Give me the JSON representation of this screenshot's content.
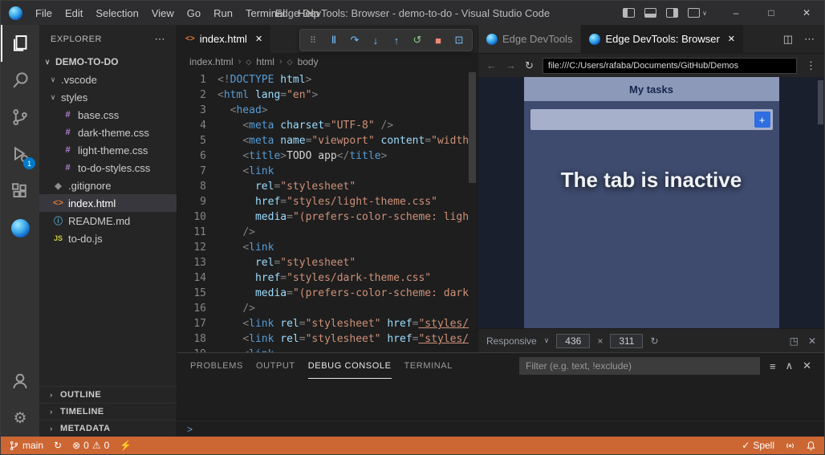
{
  "titlebar": {
    "title": "Edge DevTools: Browser - demo-to-do - Visual Studio Code",
    "menus": [
      "File",
      "Edit",
      "Selection",
      "View",
      "Go",
      "Run",
      "Terminal",
      "Help"
    ]
  },
  "activity_bar": {
    "debug_badge": "1"
  },
  "explorer": {
    "header": "EXPLORER",
    "root": "DEMO-TO-DO",
    "files": [
      {
        "name": ".vscode",
        "type": "folder",
        "icon": "chevron-down-icon",
        "indent": 1
      },
      {
        "name": "styles",
        "type": "folder",
        "icon": "chevron-down-icon",
        "indent": 1
      },
      {
        "name": "base.css",
        "icon": "css-icon",
        "indent": 2
      },
      {
        "name": "dark-theme.css",
        "icon": "css-icon",
        "indent": 2
      },
      {
        "name": "light-theme.css",
        "icon": "css-icon",
        "indent": 2
      },
      {
        "name": "to-do-styles.css",
        "icon": "css-icon",
        "indent": 2
      },
      {
        "name": ".gitignore",
        "icon": "git-icon",
        "indent": 1
      },
      {
        "name": "index.html",
        "icon": "html-icon",
        "indent": 1,
        "selected": true
      },
      {
        "name": "README.md",
        "icon": "info-icon",
        "indent": 1
      },
      {
        "name": "to-do.js",
        "icon": "js-icon",
        "indent": 1
      }
    ],
    "sections": [
      "OUTLINE",
      "TIMELINE",
      "METADATA"
    ]
  },
  "editor": {
    "tab": "index.html",
    "breadcrumbs": [
      "index.html",
      "html",
      "body"
    ],
    "lines": [
      {
        "n": "1",
        "toks": [
          [
            "p",
            "<!"
          ],
          [
            "t",
            "DOCTYPE"
          ],
          [
            "a",
            " html"
          ],
          [
            "p",
            ">"
          ]
        ]
      },
      {
        "n": "2",
        "toks": [
          [
            "p",
            "<"
          ],
          [
            "t",
            "html"
          ],
          [
            "a",
            " lang"
          ],
          [
            "p",
            "="
          ],
          [
            "s",
            "\"en\""
          ],
          [
            "p",
            ">"
          ]
        ]
      },
      {
        "n": "3",
        "toks": [
          [
            "d",
            "  "
          ],
          [
            "p",
            "<"
          ],
          [
            "t",
            "head"
          ],
          [
            "p",
            ">"
          ]
        ]
      },
      {
        "n": "4",
        "toks": [
          [
            "d",
            "    "
          ],
          [
            "p",
            "<"
          ],
          [
            "t",
            "meta"
          ],
          [
            "a",
            " charset"
          ],
          [
            "p",
            "="
          ],
          [
            "s",
            "\"UTF-8\""
          ],
          [
            "d",
            " "
          ],
          [
            "p",
            "/>"
          ]
        ]
      },
      {
        "n": "5",
        "toks": [
          [
            "d",
            "    "
          ],
          [
            "p",
            "<"
          ],
          [
            "t",
            "meta"
          ],
          [
            "a",
            " name"
          ],
          [
            "p",
            "="
          ],
          [
            "s",
            "\"viewport\""
          ],
          [
            "a",
            " content"
          ],
          [
            "p",
            "="
          ],
          [
            "s",
            "\"width"
          ]
        ]
      },
      {
        "n": "6",
        "toks": [
          [
            "d",
            "    "
          ],
          [
            "p",
            "<"
          ],
          [
            "t",
            "title"
          ],
          [
            "p",
            ">"
          ],
          [
            "d",
            "TODO app"
          ],
          [
            "p",
            "</"
          ],
          [
            "t",
            "title"
          ],
          [
            "p",
            ">"
          ]
        ]
      },
      {
        "n": "7",
        "toks": [
          [
            "d",
            "    "
          ],
          [
            "p",
            "<"
          ],
          [
            "t",
            "link"
          ]
        ]
      },
      {
        "n": "8",
        "toks": [
          [
            "d",
            "      "
          ],
          [
            "a",
            "rel"
          ],
          [
            "p",
            "="
          ],
          [
            "s",
            "\"stylesheet\""
          ]
        ]
      },
      {
        "n": "9",
        "toks": [
          [
            "d",
            "      "
          ],
          [
            "a",
            "href"
          ],
          [
            "p",
            "="
          ],
          [
            "s",
            "\"styles/light-theme.css\""
          ]
        ]
      },
      {
        "n": "10",
        "toks": [
          [
            "d",
            "      "
          ],
          [
            "a",
            "media"
          ],
          [
            "p",
            "="
          ],
          [
            "s",
            "\"(prefers-color-scheme: ligh"
          ]
        ]
      },
      {
        "n": "11",
        "toks": [
          [
            "d",
            "    "
          ],
          [
            "p",
            "/>"
          ]
        ]
      },
      {
        "n": "12",
        "toks": [
          [
            "d",
            "    "
          ],
          [
            "p",
            "<"
          ],
          [
            "t",
            "link"
          ]
        ]
      },
      {
        "n": "13",
        "toks": [
          [
            "d",
            "      "
          ],
          [
            "a",
            "rel"
          ],
          [
            "p",
            "="
          ],
          [
            "s",
            "\"stylesheet\""
          ]
        ]
      },
      {
        "n": "14",
        "toks": [
          [
            "d",
            "      "
          ],
          [
            "a",
            "href"
          ],
          [
            "p",
            "="
          ],
          [
            "s",
            "\"styles/dark-theme.css\""
          ]
        ]
      },
      {
        "n": "15",
        "toks": [
          [
            "d",
            "      "
          ],
          [
            "a",
            "media"
          ],
          [
            "p",
            "="
          ],
          [
            "s",
            "\"(prefers-color-scheme: dark"
          ]
        ]
      },
      {
        "n": "16",
        "toks": [
          [
            "d",
            "    "
          ],
          [
            "p",
            "/>"
          ]
        ]
      },
      {
        "n": "17",
        "toks": [
          [
            "d",
            "    "
          ],
          [
            "p",
            "<"
          ],
          [
            "t",
            "link"
          ],
          [
            "a",
            " rel"
          ],
          [
            "p",
            "="
          ],
          [
            "s",
            "\"stylesheet\""
          ],
          [
            "a",
            " href"
          ],
          [
            "p",
            "="
          ],
          [
            "u",
            "\"styles/"
          ]
        ]
      },
      {
        "n": "18",
        "toks": [
          [
            "d",
            "    "
          ],
          [
            "p",
            "<"
          ],
          [
            "t",
            "link"
          ],
          [
            "a",
            " rel"
          ],
          [
            "p",
            "="
          ],
          [
            "s",
            "\"stylesheet\""
          ],
          [
            "a",
            " href"
          ],
          [
            "p",
            "="
          ],
          [
            "u",
            "\"styles/"
          ]
        ]
      },
      {
        "n": "19",
        "toks": [
          [
            "d",
            "    "
          ],
          [
            "p",
            "<"
          ],
          [
            "t",
            "link"
          ]
        ]
      }
    ]
  },
  "devtools": {
    "tabs": [
      "Edge DevTools",
      "Edge DevTools: Browser"
    ],
    "url": "file:///C:/Users/rafaba/Documents/GitHub/Demos",
    "page": {
      "header": "My tasks",
      "overlay": "The tab is inactive"
    },
    "device_bar": {
      "mode": "Responsive",
      "width": "436",
      "height": "311"
    }
  },
  "panel": {
    "tabs": [
      "PROBLEMS",
      "OUTPUT",
      "DEBUG CONSOLE",
      "TERMINAL"
    ],
    "filter_placeholder": "Filter (e.g. text, !exclude)"
  },
  "status_bar": {
    "branch": "main",
    "errors": "0",
    "warnings": "0",
    "spell": "Spell"
  },
  "colors": {
    "statusbar_bg": "#CC6633",
    "badge": "#007ACC"
  },
  "icons": {
    "more": "⋯",
    "kebab": "⋮",
    "close": "✕",
    "minimize": "–",
    "maximize": "□",
    "caret": "∨",
    "chevron_right": "›",
    "chevron_up": "∧",
    "back": "←",
    "forward": "→",
    "refresh": "↻",
    "rotate": "↻",
    "fit": "◳",
    "split": "◫",
    "drag": "⠿",
    "pause": "Ⅱ",
    "step_over": "↷",
    "step_into": "↓",
    "step_out": "↑",
    "restart": "↺",
    "stop": "■",
    "inspect": "⊡",
    "error": "⊗",
    "warning": "⚠",
    "flash": "⚡",
    "check": "✓",
    "prompt": ">",
    "times": "×",
    "filter": "≡",
    "breadcrumb_symbol": "◇",
    "add": "+"
  }
}
